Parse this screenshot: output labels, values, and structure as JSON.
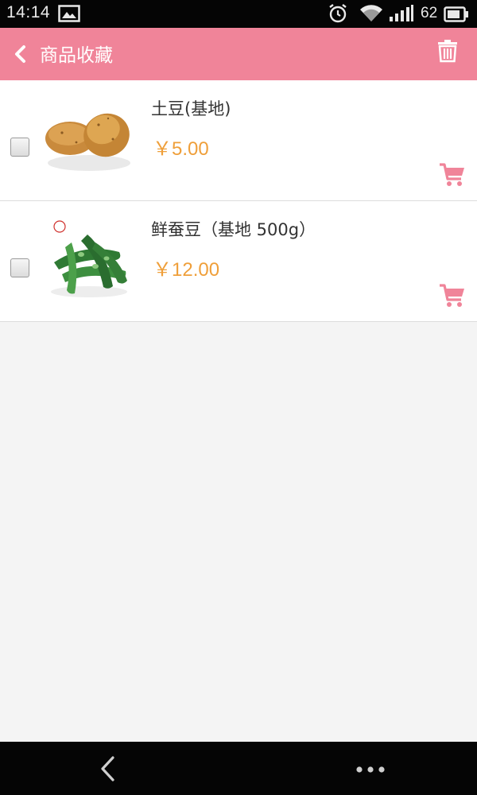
{
  "status_bar": {
    "time": "14:14",
    "battery_level": "62",
    "icons": [
      "image-icon",
      "alarm-icon",
      "wifi-icon",
      "signal-icon",
      "battery-icon"
    ]
  },
  "header": {
    "title": "商品收藏",
    "back_icon": "chevron-left-icon",
    "action_icon": "trash-icon"
  },
  "colors": {
    "accent": "#f08499",
    "price": "#ef9f3a",
    "background": "#f4f4f4"
  },
  "favorites": [
    {
      "name": "土豆(基地)",
      "price": "￥5.00",
      "checked": false,
      "image": "potato-image"
    },
    {
      "name": "鲜蚕豆（基地 500g）",
      "price": "￥12.00",
      "checked": false,
      "image": "broad-bean-image"
    }
  ],
  "nav_bar": {
    "icons": [
      "nav-back-icon",
      "nav-more-icon"
    ]
  }
}
